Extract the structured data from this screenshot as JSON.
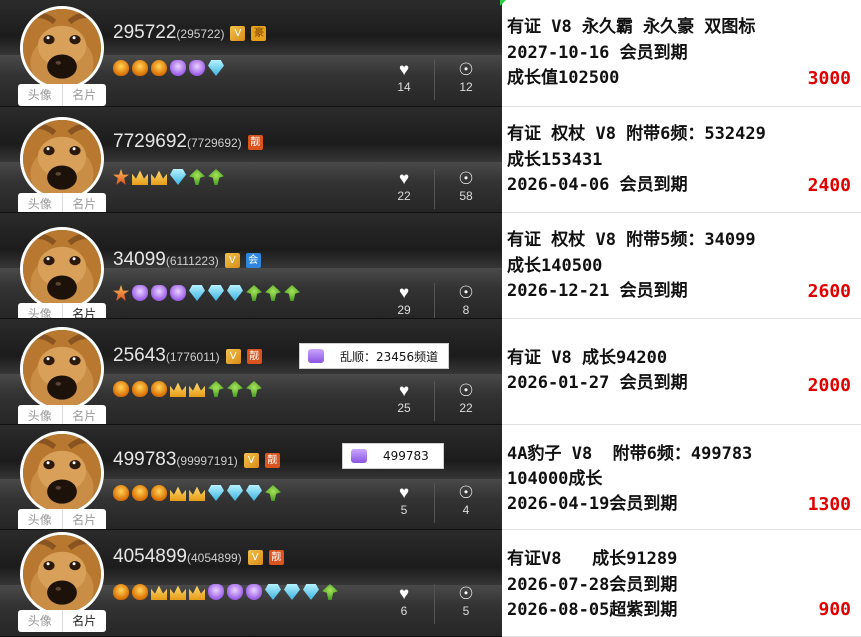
{
  "rows": [
    {
      "uid": "295722",
      "sub_id": "(295722)",
      "badges": [
        "v",
        "vip"
      ],
      "icons": [
        "crown",
        "crown",
        "crown",
        "shield",
        "shield",
        "diamond"
      ],
      "tab_avatar": "头像",
      "tab_card": "名片",
      "likes": "14",
      "awards": "12",
      "lines": [
        "有证 V8 永久霸 永久豪 双图标",
        "2027-10-16 会员到期",
        "成长值102500"
      ],
      "price": "3000"
    },
    {
      "uid": "7729692",
      "sub_id": "(7729692)",
      "badges": [
        "hao"
      ],
      "icons": [
        "star",
        "crown2",
        "crown2",
        "diamond",
        "leaf",
        "leaf"
      ],
      "tab_avatar": "头像",
      "tab_card": "名片",
      "likes": "22",
      "awards": "58",
      "lines": [
        "有证 权杖 V8 附带6频：532429",
        "成长153431",
        "2026-04-06 会员到期"
      ],
      "price": "2400"
    },
    {
      "uid": "34099",
      "sub_id": "(6111223)",
      "badges": [
        "v",
        "mem"
      ],
      "icons": [
        "star",
        "shield",
        "shield",
        "shield",
        "diamond",
        "diamond",
        "diamond",
        "leaf",
        "leaf",
        "leaf"
      ],
      "tab_avatar": "头像",
      "tab_card": "名片",
      "likes": "29",
      "awards": "8",
      "lines": [
        "有证 权杖 V8 附带5频：34099",
        "成长140500",
        "2026-12-21 会员到期"
      ],
      "price": "2600"
    },
    {
      "uid": "25643",
      "sub_id": "(1776011)",
      "badges": [
        "v",
        "hao"
      ],
      "icons": [
        "crown",
        "crown",
        "crown",
        "crown2",
        "crown2",
        "leaf",
        "leaf",
        "leaf"
      ],
      "tab_avatar": "头像",
      "tab_card": "名片",
      "likes": "25",
      "awards": "22",
      "tooltip": "乱顺：23456频道",
      "lines": [
        "有证 V8 成长94200",
        "2026-01-27 会员到期"
      ],
      "price": "2000"
    },
    {
      "uid": "499783",
      "sub_id": "(99997191)",
      "badges": [
        "v",
        "hao"
      ],
      "icons": [
        "crown",
        "crown",
        "crown",
        "crown2",
        "crown2",
        "diamond",
        "diamond",
        "diamond",
        "leaf"
      ],
      "tab_avatar": "头像",
      "tab_card": "名片",
      "likes": "5",
      "awards": "4",
      "tooltip": "499783",
      "lines": [
        "4A豹子 V8  附带6频：499783",
        "104000成长",
        "2026-04-19会员到期"
      ],
      "price": "1300"
    },
    {
      "uid": "4054899",
      "sub_id": "(4054899)",
      "badges": [
        "v",
        "hao"
      ],
      "icons": [
        "crown",
        "crown",
        "crown2",
        "crown2",
        "crown2",
        "shield",
        "shield",
        "shield",
        "diamond",
        "diamond",
        "diamond",
        "leaf"
      ],
      "tab_avatar": "头像",
      "tab_card": "名片",
      "likes": "6",
      "awards": "5",
      "lines": [
        "有证V8   成长91289",
        "2026-07-28会员到期",
        "2026-08-05超紫到期"
      ],
      "price": "900"
    }
  ],
  "badge_text": {
    "v": "V",
    "hao": "靓",
    "mem": "会",
    "vip": "豪"
  },
  "icons": {
    "like": "heart-icon",
    "award": "medal-icon"
  }
}
